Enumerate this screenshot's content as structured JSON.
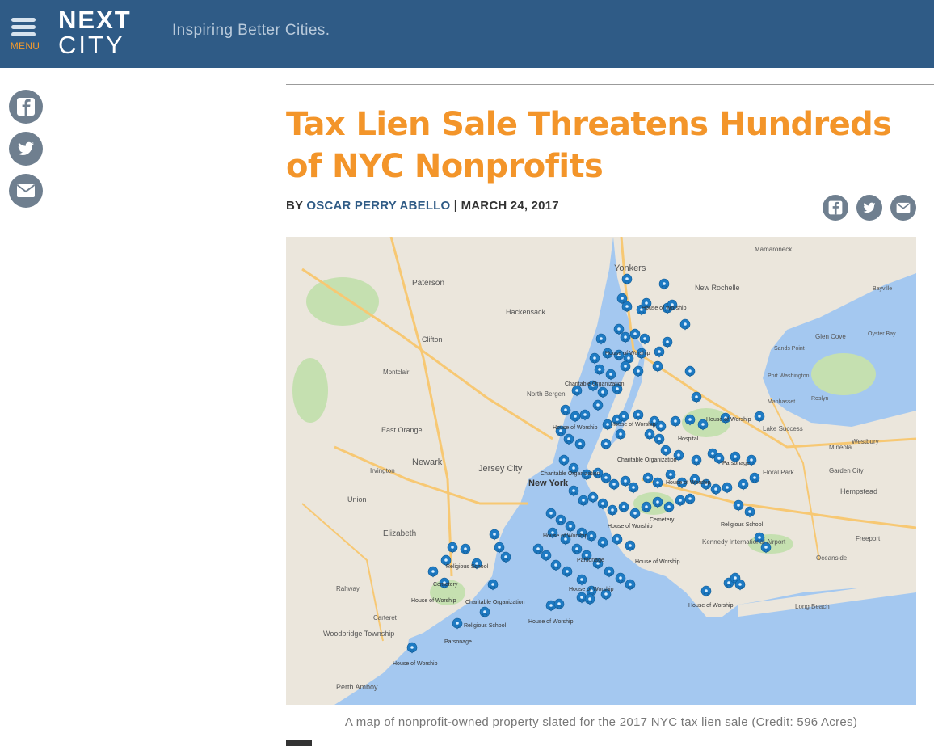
{
  "header": {
    "menu_label": "MENU",
    "logo_top": "NEXT",
    "logo_bottom": "CITY",
    "tagline": "Inspiring Better Cities."
  },
  "share_side": [
    "facebook-icon",
    "twitter-icon",
    "mail-icon"
  ],
  "article": {
    "title": "Tax Lien Sale Threatens Hundreds of NYC Nonprofits",
    "by_label": "BY",
    "author": "OSCAR PERRY ABELLO",
    "separator": "|",
    "date": "MARCH 24, 2017"
  },
  "map": {
    "place_labels": {
      "yonkers": "Yonkers",
      "paterson": "Paterson",
      "hackensack": "Hackensack",
      "newark": "Newark",
      "jersey_city": "Jersey City",
      "new_york": "New York",
      "elizabeth": "Elizabeth",
      "new_rochelle": "New Rochelle",
      "mamaroneck": "Mamaroneck",
      "glen_cove": "Glen Cove",
      "hempstead": "Hempstead",
      "long_beach": "Long Beach",
      "union": "Union",
      "perth_amboy": "Perth Amboy",
      "woodbridge": "Woodbridge Township",
      "montclair": "Montclair",
      "east_orange": "East Orange",
      "clifton": "Clifton",
      "north_bergen": "North Bergen",
      "irvington": "Irvington",
      "freeport": "Freeport",
      "oceanside": "Oceanside",
      "mineola": "Mineola",
      "garden_city": "Garden City",
      "port_washington": "Port Washington",
      "sands_point": "Sands Point",
      "lake_success": "Lake Success",
      "rahway": "Rahway",
      "kennedy_airport": "Kennedy International Airport",
      "westbury": "Westbury",
      "floral_park": "Floral Park",
      "carteret": "Carteret",
      "oyster_bay": "Oyster Bay",
      "bayville": "Bayville",
      "manhasset": "Manhasset",
      "roslyn": "Roslyn"
    },
    "marker_labels": {
      "house_of_worship": "House of Worship",
      "religious_school": "Religious School",
      "charitable_org": "Charitable Organization",
      "parsonage": "Parsonage",
      "cemetery": "Cemetery",
      "hospital": "Hospital"
    },
    "colors": {
      "water": "#a4c8f0",
      "land": "#ebe6dc",
      "park": "#c5e0b0",
      "marker": "#1e7bc4",
      "highway": "#f7c873"
    }
  },
  "caption": "A map of nonprofit-owned property slated for the 2017 NYC tax lien sale (Credit: 596 Acres)"
}
